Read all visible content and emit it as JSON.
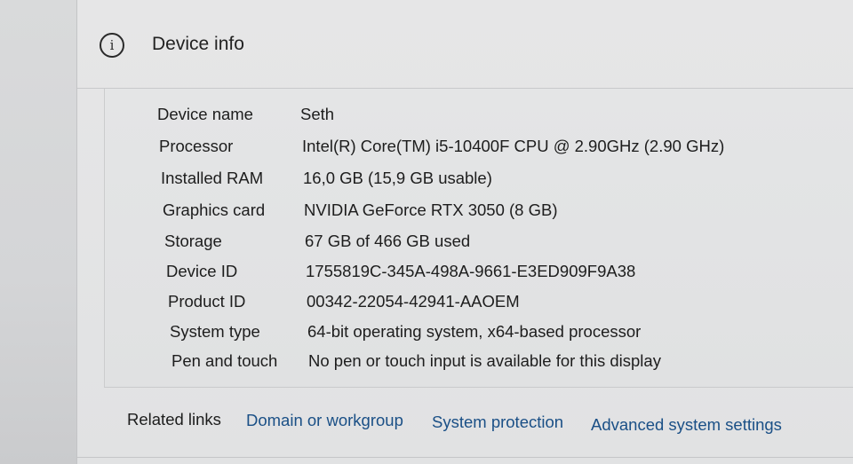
{
  "section": {
    "icon": "info-icon",
    "title": "Device info"
  },
  "specs": [
    {
      "label": "Device name",
      "value": "Seth"
    },
    {
      "label": "Processor",
      "value": "Intel(R) Core(TM) i5-10400F CPU @ 2.90GHz (2.90 GHz)"
    },
    {
      "label": "Installed RAM",
      "value": "16,0 GB (15,9 GB usable)"
    },
    {
      "label": "Graphics card",
      "value": "NVIDIA GeForce RTX 3050 (8 GB)"
    },
    {
      "label": "Storage",
      "value": "67 GB of 466 GB used"
    },
    {
      "label": "Device ID",
      "value": "1755819C-345A-498A-9661-E3ED909F9A38"
    },
    {
      "label": "Product ID",
      "value": "00342-22054-42941-AAOEM"
    },
    {
      "label": "System type",
      "value": "64-bit operating system, x64-based processor"
    },
    {
      "label": "Pen and touch",
      "value": "No pen or touch input is available for this display"
    }
  ],
  "related_links": {
    "title": "Related links",
    "items": [
      "Domain or workgroup",
      "System protection",
      "Advanced system settings"
    ]
  },
  "colors": {
    "link": "#1a4f86",
    "text": "#1d1d1d"
  }
}
